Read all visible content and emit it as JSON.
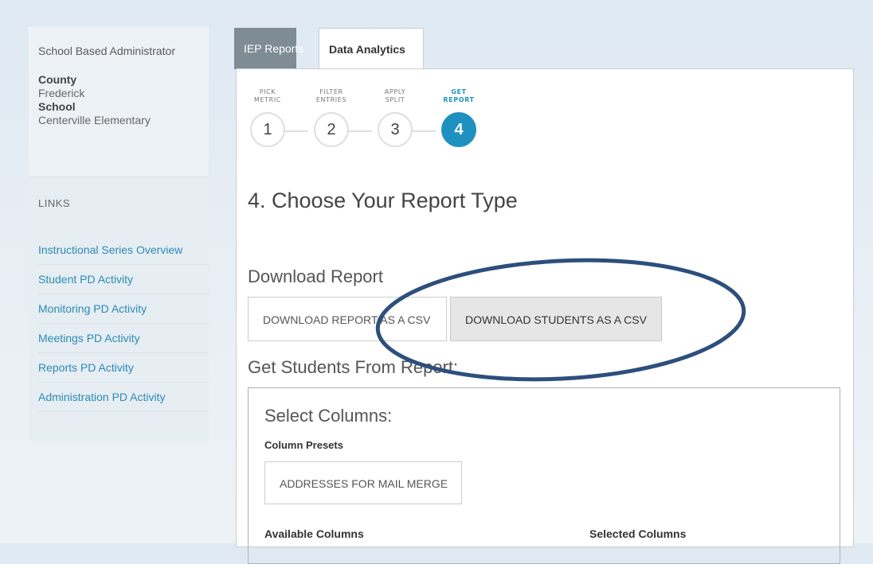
{
  "sidebar": {
    "role": "School Based Administrator",
    "county_label": "County",
    "county_value": "Frederick",
    "school_label": "School",
    "school_value": "Centerville Elementary",
    "links_title": "LINKS",
    "links": [
      "Instructional Series Overview",
      "Student PD Activity",
      "Monitoring PD Activity",
      "Meetings PD Activity",
      "Reports PD Activity",
      "Administration PD Activity"
    ]
  },
  "tabs": [
    "IEP Reports",
    "Data Analytics"
  ],
  "steps": [
    {
      "label_line1": "PICK",
      "label_line2": "METRIC",
      "number": "1"
    },
    {
      "label_line1": "FILTER",
      "label_line2": "ENTRIES",
      "number": "2"
    },
    {
      "label_line1": "APPLY",
      "label_line2": "SPLIT",
      "number": "3"
    },
    {
      "label_line1": "GET",
      "label_line2": "REPORT",
      "number": "4"
    }
  ],
  "active_step": 4,
  "main": {
    "heading": "4. Choose Your Report Type",
    "download_section": "Download Report",
    "download_report_csv": "DOWNLOAD REPORT AS A CSV",
    "download_students_csv": "DOWNLOAD STUDENTS AS A CSV",
    "get_students": "Get Students From Report:",
    "select_columns": "Select Columns:",
    "column_presets": "Column Presets",
    "preset_button": "ADDRESSES FOR MAIL MERGE",
    "available_columns": "Available Columns",
    "selected_columns": "Selected Columns"
  },
  "colors": {
    "accent": "#1f91c0",
    "link": "#2b8ab5",
    "annotation": "#2c4f7c",
    "tab_inactive": "#7e8c94"
  }
}
